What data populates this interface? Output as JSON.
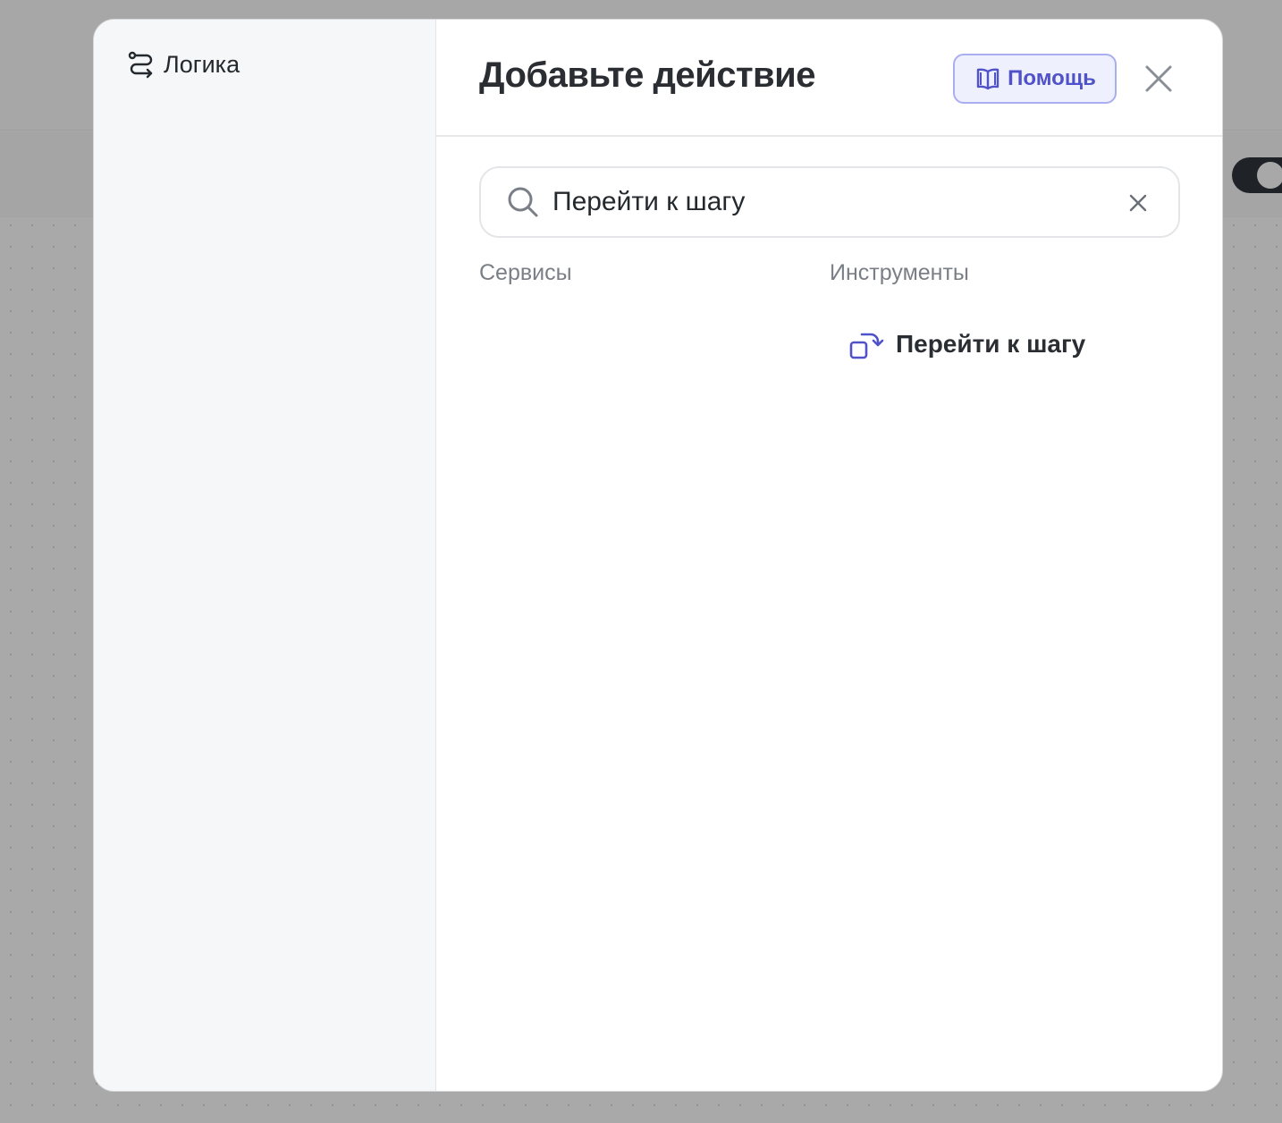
{
  "sidebar": {
    "items": [
      {
        "label": "Логика",
        "icon": "logic-route-icon"
      }
    ]
  },
  "header": {
    "title": "Добавьте действие",
    "help_label": "Помощь",
    "help_icon": "book-icon",
    "close_icon": "close-icon"
  },
  "search": {
    "value": "Перейти к шагу",
    "placeholder": ""
  },
  "columns": {
    "services_title": "Сервисы",
    "tools_title": "Инструменты"
  },
  "tools": [
    {
      "label": "Перейти к шагу",
      "icon": "go-to-step-icon"
    }
  ],
  "colors": {
    "accent": "#4f52c9",
    "accent_bg": "#eef0fe",
    "text": "#2a2d32",
    "muted": "#7a7f87"
  }
}
